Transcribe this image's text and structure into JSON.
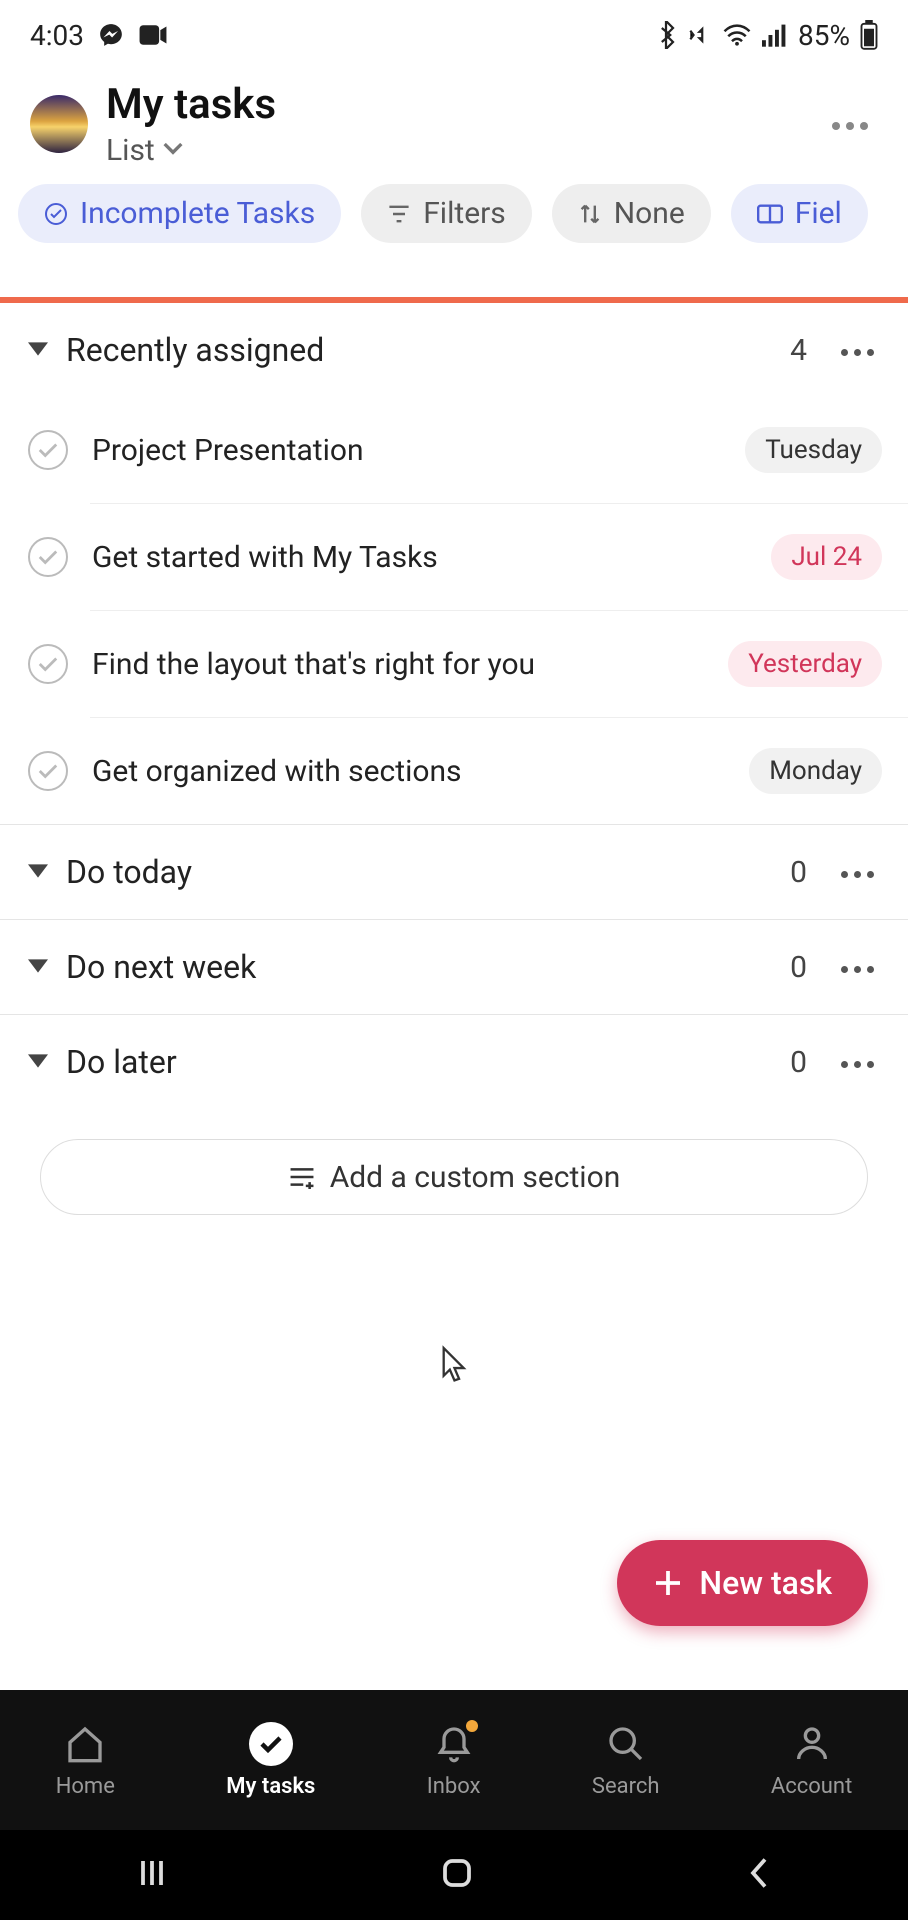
{
  "status_bar": {
    "time": "4:03",
    "battery_text": "85%"
  },
  "header": {
    "title": "My tasks",
    "view_label": "List"
  },
  "pills": {
    "incomplete": "Incomplete Tasks",
    "filters": "Filters",
    "sort": "None",
    "fields": "Fiel"
  },
  "sections": [
    {
      "title": "Recently assigned",
      "count": "4"
    },
    {
      "title": "Do today",
      "count": "0"
    },
    {
      "title": "Do next week",
      "count": "0"
    },
    {
      "title": "Do later",
      "count": "0"
    }
  ],
  "tasks": [
    {
      "title": "Project Presentation",
      "due": "Tuesday",
      "overdue": false
    },
    {
      "title": "Get started with My Tasks",
      "due": "Jul 24",
      "overdue": true
    },
    {
      "title": "Find the layout that's right for you",
      "due": "Yesterday",
      "overdue": true
    },
    {
      "title": "Get organized with sections",
      "due": "Monday",
      "overdue": false
    }
  ],
  "add_section_label": "Add a custom section",
  "fab_label": "New task",
  "nav": {
    "home": "Home",
    "my_tasks": "My tasks",
    "inbox": "Inbox",
    "search": "Search",
    "account": "Account"
  }
}
